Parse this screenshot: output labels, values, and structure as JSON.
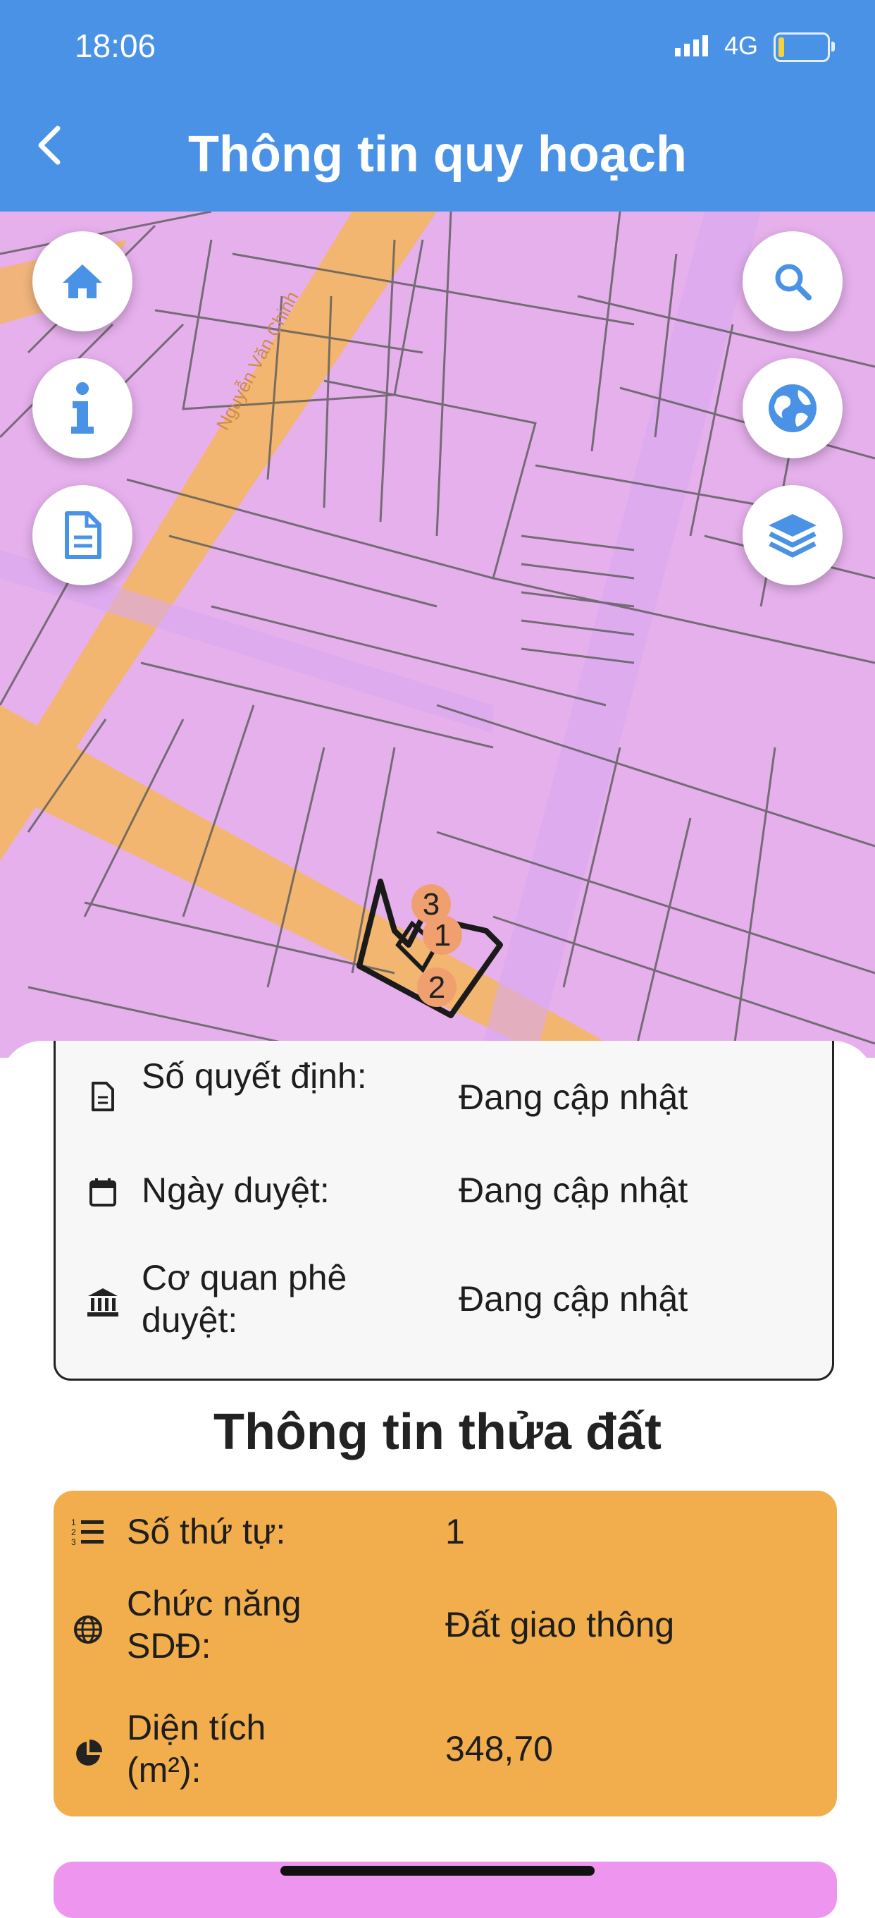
{
  "status_bar": {
    "time": "18:06",
    "network": "4G"
  },
  "header": {
    "title": "Thông tin quy hoạch"
  },
  "map": {
    "street_label": "Nguyễn Văn Chinh",
    "markers": [
      "3",
      "1",
      "2"
    ],
    "colors": {
      "land": "#e6b0ec",
      "road": "#f2b670",
      "lines": "#555555",
      "marker": "#f0a06e"
    }
  },
  "decision_info": {
    "rows": [
      {
        "label": "Số quyết định:",
        "value": "Đang cập nhật",
        "icon": "document-icon"
      },
      {
        "label": "Ngày duyệt:",
        "value": "Đang cập nhật",
        "icon": "calendar-icon"
      },
      {
        "label": "Cơ quan phê duyệt:",
        "value": "Đang cập nhật",
        "icon": "bank-icon"
      }
    ]
  },
  "parcel": {
    "title": "Thông tin thửa đất",
    "color": "#f2ae4c",
    "rows": [
      {
        "label": "Số thứ tự:",
        "value": "1",
        "icon": "ordered-list-icon"
      },
      {
        "label": "Chức năng SDĐ:",
        "value": "Đất giao thông",
        "icon": "globe-icon"
      },
      {
        "label": "Diện tích (m²):",
        "value": "348,70",
        "icon": "pie-chart-icon"
      }
    ]
  },
  "accent_color": "#4a92e6"
}
